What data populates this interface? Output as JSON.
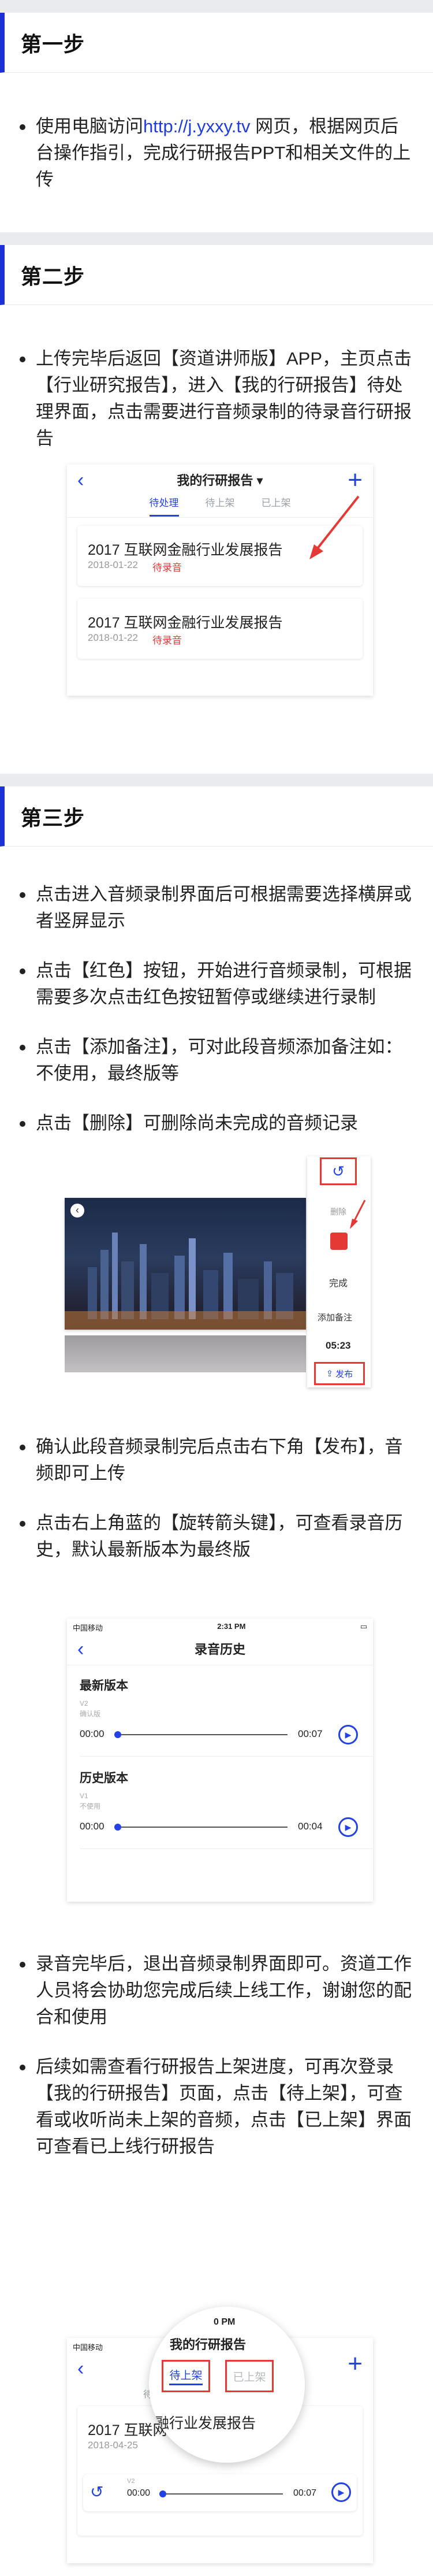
{
  "step1": {
    "title": "第一步",
    "text_a": "使用电脑访问",
    "url": "http://j.yxxy.tv",
    "text_b": " 网页，根据网页后台操作指引，完成行研报告PPT和相关文件的上传"
  },
  "step2": {
    "title": "第二步",
    "text": "上传完毕后返回【资道讲师版】APP，主页点击【行业研究报告】，进入【我的行研报告】待处理界面，点击需要进行音频录制的待录音行研报告",
    "mock": {
      "nav_title": "我的行研报告 ▾",
      "tabs": [
        "待处理",
        "待上架",
        "已上架"
      ],
      "cards": [
        {
          "title": "2017 互联网金融行业发展报告",
          "date": "2018-01-22",
          "status": "待录音"
        },
        {
          "title": "2017 互联网金融行业发展报告",
          "date": "2018-01-22",
          "status": "待录音"
        }
      ]
    }
  },
  "step3": {
    "title": "第三步",
    "bullets": [
      "点击进入音频录制界面后可根据需要选择横屏或者竖屏显示",
      "点击【红色】按钮，开始进行音频录制，可根据需要多次点击红色按钮暂停或继续进行录制",
      "点击【添加备注】，可对此段音频添加备注如：不使用，最终版等",
      "点击【删除】可删除尚未完成的音频记录"
    ],
    "rec_panel": {
      "delete": "删除",
      "done": "完成",
      "add_note": "添加备注",
      "time": "05:23",
      "publish": "发布"
    },
    "bullets2": [
      "确认此段音频录制完后点击右下角【发布】，音频即可上传",
      "点击右上角蓝的【旋转箭头键】，可查看录音历史，默认最新版本为最终版"
    ],
    "history": {
      "carrier": "中国移动",
      "clock": "2:31 PM",
      "nav_title": "录音历史",
      "latest_heading": "最新版本",
      "latest_ver": "V2",
      "latest_note": "确认版",
      "latest_start": "00:00",
      "latest_end": "00:07",
      "history_heading": "历史版本",
      "old_ver": "V1",
      "old_note": "不使用",
      "old_start": "00:00",
      "old_end": "00:04"
    },
    "bullets3": [
      "录音完毕后，退出音频录制界面即可。资道工作人员将会协助您完成后续上线工作，谢谢您的配合和使用",
      "后续如需查看行研报告上架进度，可再次登录【我的行研报告】页面，点击【待上架】，可查看或收听尚未上架的音频，点击【已上架】界面可查看已上线行研报告"
    ],
    "final_mock": {
      "carrier": "中国移动",
      "clock_partial": "0 PM",
      "zoom_title": "我的行研报告",
      "zoom_tab_on": "待上架",
      "zoom_tab_off": "已上架",
      "zoom_text": "融行业发展报告",
      "tab_left": "待处理",
      "card_title": "2017 互联网金融",
      "card_date": "2018-04-25",
      "v": "V2",
      "start": "00:00",
      "end": "00:07"
    }
  }
}
